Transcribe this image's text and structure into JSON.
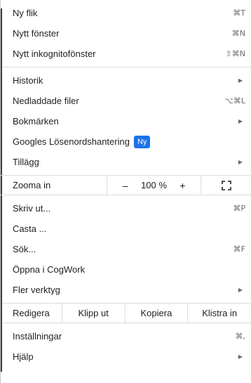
{
  "menu": {
    "group1": [
      {
        "label": "Ny flik",
        "shortcut": "⌘T"
      },
      {
        "label": "Nytt fönster",
        "shortcut": "⌘N"
      },
      {
        "label": "Nytt inkognitofönster",
        "shortcut": "⇧⌘N"
      }
    ],
    "group2": [
      {
        "label": "Historik",
        "arrow": "▶"
      },
      {
        "label": "Nedladdade filer",
        "shortcut": "⌥⌘L"
      },
      {
        "label": "Bokmärken",
        "arrow": "▶"
      },
      {
        "label": "Googles Lösenordshantering",
        "badge": "Ny"
      },
      {
        "label": "Tillägg",
        "arrow": "▶"
      }
    ],
    "zoom": {
      "label": "Zooma in",
      "minus": "–",
      "value": "100 %",
      "plus": "+"
    },
    "group3": [
      {
        "label": "Skriv ut...",
        "shortcut": "⌘P"
      },
      {
        "label": "Casta ..."
      },
      {
        "label": "Sök...",
        "shortcut": "⌘F"
      },
      {
        "label": "Öppna i CogWork"
      },
      {
        "label": "Fler verktyg",
        "arrow": "▶"
      }
    ],
    "edit": {
      "redigera": "Redigera",
      "klipp_ut": "Klipp ut",
      "kopiera": "Kopiera",
      "klistra_in": "Klistra in"
    },
    "group4": [
      {
        "label": "Inställningar",
        "shortcut": "⌘,"
      },
      {
        "label": "Hjälp",
        "arrow": "▶"
      }
    ]
  }
}
